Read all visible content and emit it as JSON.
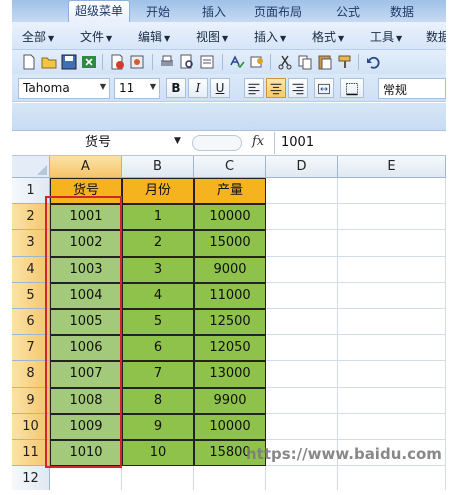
{
  "ribbon": {
    "tabs": [
      "超级菜单",
      "开始",
      "插入",
      "页面布局",
      "公式",
      "数据"
    ],
    "active_tab_index": 0
  },
  "menubar": {
    "items": [
      "全部",
      "文件",
      "编辑",
      "视图",
      "插入",
      "格式",
      "工具",
      "数据"
    ]
  },
  "toolbar2": {
    "font_name": "Tahoma",
    "font_size": "11",
    "bold": "B",
    "italic": "I",
    "underline": "U",
    "number_format": "常规"
  },
  "formula_bar": {
    "name_box": "货号",
    "fx_label": "fx",
    "value": "1001"
  },
  "sheet": {
    "columns": [
      "A",
      "B",
      "C",
      "D",
      "E"
    ],
    "rows": [
      "1",
      "2",
      "3",
      "4",
      "5",
      "6",
      "7",
      "8",
      "9",
      "10",
      "11",
      "12"
    ],
    "header_row": [
      "货号",
      "月份",
      "产量"
    ],
    "data": [
      [
        "1001",
        "1",
        "10000"
      ],
      [
        "1002",
        "2",
        "15000"
      ],
      [
        "1003",
        "3",
        "9000"
      ],
      [
        "1004",
        "4",
        "11000"
      ],
      [
        "1005",
        "5",
        "12500"
      ],
      [
        "1006",
        "6",
        "12050"
      ],
      [
        "1007",
        "7",
        "13000"
      ],
      [
        "1008",
        "8",
        "9900"
      ],
      [
        "1009",
        "9",
        "10000"
      ],
      [
        "1010",
        "10",
        "15800"
      ]
    ]
  },
  "colors": {
    "header_fill": "#f5b320",
    "data_fill": "#8ec24a",
    "selection_outline": "#d6242a"
  },
  "watermark": "https://www.baidu.com"
}
